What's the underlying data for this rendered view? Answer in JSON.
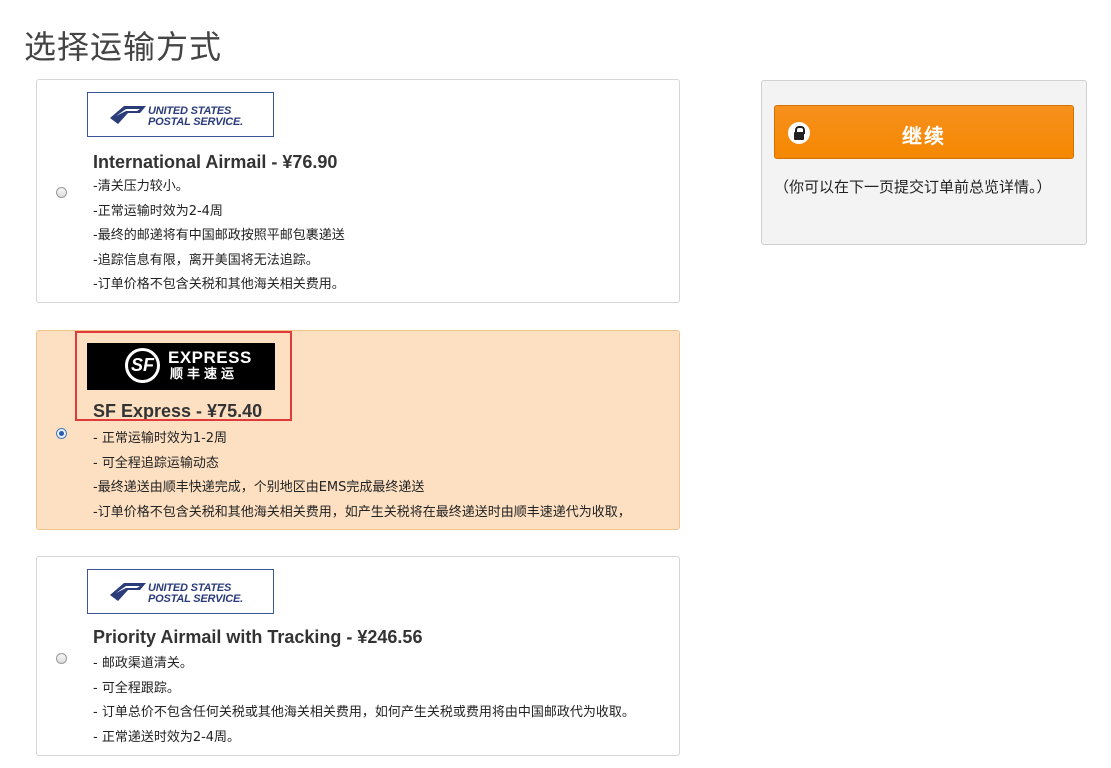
{
  "page": {
    "title": "选择运输方式"
  },
  "options": [
    {
      "logo": "UNITED STATES POSTAL SERVICE",
      "logo_line1": "UNITED STATES",
      "logo_line2": "POSTAL SERVICE.",
      "title": "International Airmail - ¥76.90",
      "selected": false,
      "lines": [
        "-清关压力较小。",
        "-正常运输时效为2-4周",
        "-最终的邮递将有中国邮政按照平邮包裹递送",
        "-追踪信息有限，离开美国将无法追踪。",
        "-订单价格不包含关税和其他海关相关费用。"
      ]
    },
    {
      "logo_sf": "SF",
      "logo_express": "EXPRESS",
      "logo_cn": "顺丰速运",
      "title": "SF Express - ¥75.40",
      "selected": true,
      "lines": [
        "- 正常运输时效为1-2周",
        "- 可全程追踪运输动态",
        "-最终递送由顺丰快递完成，个别地区由EMS完成最终递送",
        "-订单价格不包含关税和其他海关相关费用，如产生关税将在最终递送时由顺丰速递代为收取，"
      ]
    },
    {
      "logo": "UNITED STATES POSTAL SERVICE",
      "logo_line1": "UNITED STATES",
      "logo_line2": "POSTAL SERVICE.",
      "title": "Priority Airmail with Tracking - ¥246.56",
      "selected": false,
      "lines": [
        "- 邮政渠道清关。",
        "- 可全程跟踪。",
        "- 订单总价不包含任何关税或其他海关相关费用，如何产生关税或费用将由中国邮政代为收取。",
        "- 正常递送时效为2-4周。"
      ]
    }
  ],
  "summary": {
    "continue_label": "继续",
    "note": "（你可以在下一页提交订单前总览详情。）"
  },
  "colors": {
    "accent": "#f58800",
    "selected_bg": "#fde0c2",
    "highlight": "#e03a3a"
  }
}
